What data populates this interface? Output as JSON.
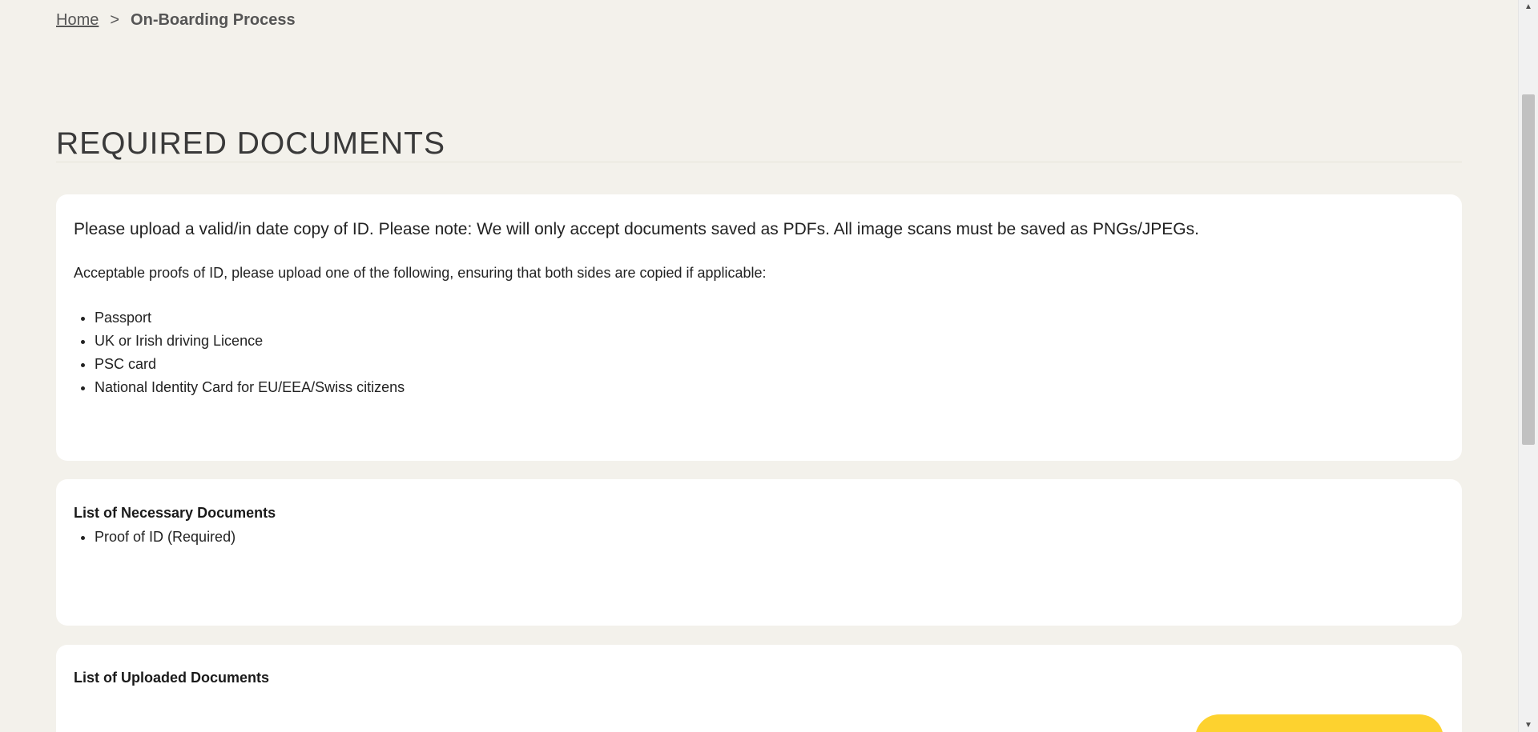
{
  "breadcrumb": {
    "home": "Home",
    "separator": ">",
    "current": "On-Boarding Process"
  },
  "page_title": "REQUIRED DOCUMENTS",
  "instructions": {
    "intro": "Please upload a valid/in date copy of ID. Please note: We will only accept documents saved as PDFs. All image scans must be saved as PNGs/JPEGs.",
    "subintro": "Acceptable proofs of ID, please upload one of the following, ensuring that both sides are copied if applicable:",
    "items": [
      "Passport",
      "UK or Irish driving Licence",
      "PSC card",
      "National Identity Card for EU/EEA/Swiss citizens"
    ]
  },
  "necessary_documents": {
    "heading": "List of Necessary Documents",
    "items": [
      "Proof of ID (Required)"
    ]
  },
  "uploaded_documents": {
    "heading": "List of Uploaded Documents"
  },
  "colors": {
    "page_background": "#f3f1eb",
    "card_background": "#ffffff",
    "accent_button": "#fdd22f"
  },
  "icons": {
    "scroll_up": "scroll-up-arrow-icon",
    "scroll_down": "scroll-down-arrow-icon"
  }
}
